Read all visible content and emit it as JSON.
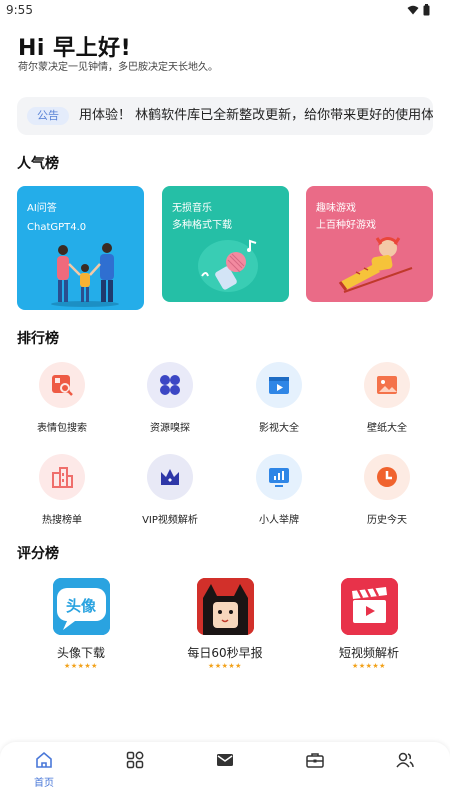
{
  "status_bar": {
    "time": "9:55",
    "icons": [
      "wifi-icon",
      "battery-icon"
    ]
  },
  "greeting": {
    "title": "Hi 早上好!",
    "subtitle": "荷尔蒙决定一见钟情，多巴胺决定天长地久。"
  },
  "notice": {
    "badge": "公告",
    "text": "用体验！   林鹤软件库已全新整改更新，给你带来更好的使用体"
  },
  "popular": {
    "title": "人气榜",
    "cards": [
      {
        "line1": "AI问答",
        "line2": "ChatGPT4.0",
        "color": "#24ade9",
        "illustration": "family-illustration"
      },
      {
        "line1": "无损音乐",
        "line2": "多种格式下载",
        "color": "#25bfa6",
        "illustration": "music-microphone-illustration"
      },
      {
        "line1": "趣味游戏",
        "line2": "上百种好游戏",
        "color": "#ea6b87",
        "illustration": "child-relaxing-illustration"
      }
    ]
  },
  "ranking": {
    "title": "排行榜",
    "items": [
      {
        "label": "表情包搜索",
        "icon": "image-search-icon",
        "bg": "#fde9e6",
        "color": "#ee5a44"
      },
      {
        "label": "资源嗅探",
        "icon": "clover-icon",
        "bg": "#e9eaf8",
        "color": "#3b46c4"
      },
      {
        "label": "影视大全",
        "icon": "video-play-icon",
        "bg": "#e5f1fd",
        "color": "#2f86e6"
      },
      {
        "label": "壁纸大全",
        "icon": "picture-icon",
        "bg": "#fdece5",
        "color": "#f4724a"
      },
      {
        "label": "热搜榜单",
        "icon": "building-chart-icon",
        "bg": "#fde9e8",
        "color": "#ef6e6b"
      },
      {
        "label": "VIP视频解析",
        "icon": "crown-icon",
        "bg": "#e8e9f6",
        "color": "#2e37a8"
      },
      {
        "label": "小人举牌",
        "icon": "monitor-chart-icon",
        "bg": "#e5f1fd",
        "color": "#2f86e6"
      },
      {
        "label": "历史今天",
        "icon": "clock-icon",
        "bg": "#fdebe3",
        "color": "#f0632e"
      }
    ]
  },
  "score": {
    "title": "评分榜",
    "items": [
      {
        "name": "头像下载",
        "icon": "avatar-app-icon",
        "icon_text": "头像",
        "stars": "★★★★★"
      },
      {
        "name": "每日60秒早报",
        "icon": "cartoon-girl-app-icon",
        "stars": "★★★★★"
      },
      {
        "name": "短视频解析",
        "icon": "clapperboard-app-icon",
        "stars": "★★★★★"
      }
    ]
  },
  "tab_bar": {
    "items": [
      {
        "label": "首页",
        "icon": "home-icon",
        "active": true
      },
      {
        "label": "",
        "icon": "grid-icon"
      },
      {
        "label": "",
        "icon": "mail-icon"
      },
      {
        "label": "",
        "icon": "toolbox-icon"
      },
      {
        "label": "",
        "icon": "users-icon"
      }
    ],
    "active_color": "#4a78d8",
    "inactive_color": "#333333"
  }
}
